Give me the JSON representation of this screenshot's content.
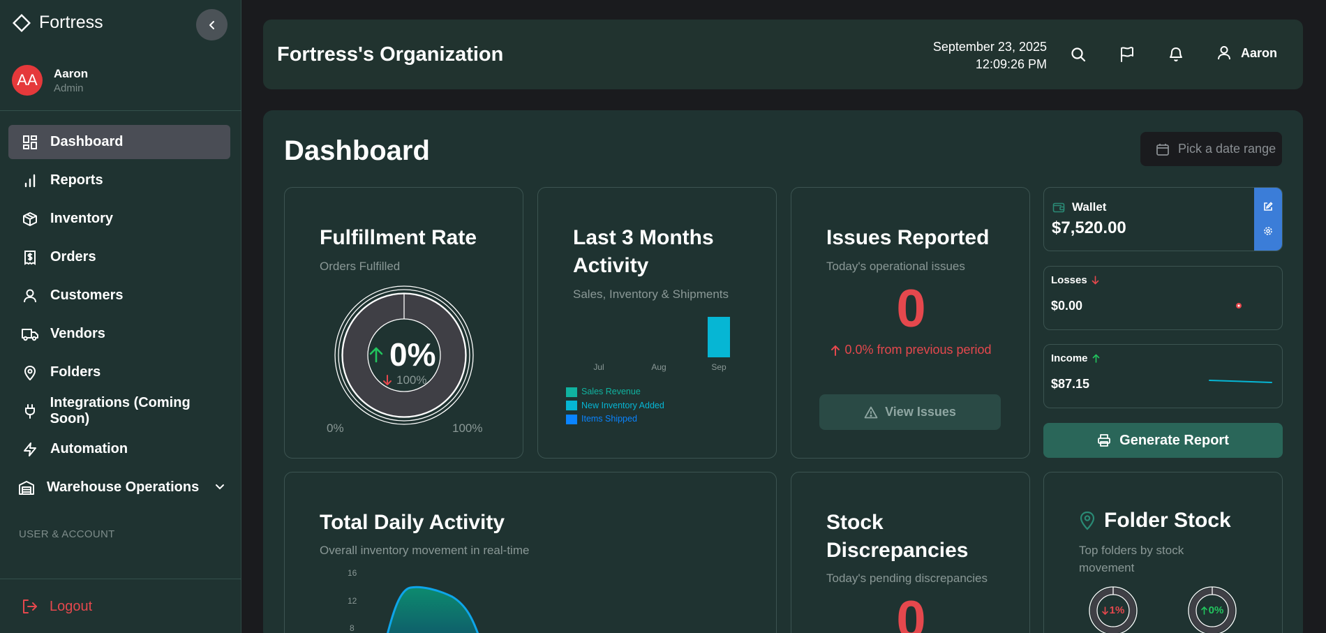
{
  "sidebar": {
    "brand": "Fortress",
    "user_name": "Aaron",
    "user_role": "Admin",
    "user_initials": "AA",
    "nav": [
      {
        "label": "Dashboard"
      },
      {
        "label": "Reports"
      },
      {
        "label": "Inventory"
      },
      {
        "label": "Orders"
      },
      {
        "label": "Customers"
      },
      {
        "label": "Vendors"
      },
      {
        "label": "Folders"
      },
      {
        "label": "Integrations (Coming Soon)"
      },
      {
        "label": "Automation"
      },
      {
        "label": "Warehouse Operations"
      }
    ],
    "section_label": "USER & ACCOUNT",
    "logout": "Logout"
  },
  "header": {
    "org_title": "Fortress's Organization",
    "date": "September 23, 2025",
    "time": "12:09:26 PM",
    "user": "Aaron"
  },
  "main": {
    "title": "Dashboard",
    "date_range_placeholder": "Pick a date range"
  },
  "fulfillment": {
    "title": "Fulfillment Rate",
    "subtitle": "Orders Fulfilled",
    "value": "0%",
    "change": "100%",
    "min_label": "0%",
    "max_label": "100%"
  },
  "activity": {
    "title_line1": "Last 3 Months",
    "title_line2": "Activity",
    "subtitle": "Sales, Inventory & Shipments",
    "legend": [
      "Sales Revenue",
      "New Inventory Added",
      "Items Shipped"
    ]
  },
  "issues": {
    "title": "Issues Reported",
    "subtitle": "Today's operational issues",
    "count": "0",
    "change": "0.0% from previous period",
    "button": "View Issues"
  },
  "wallet": {
    "label": "Wallet",
    "amount": "$7,520.00"
  },
  "losses": {
    "label": "Losses",
    "amount": "$0.00"
  },
  "income": {
    "label": "Income",
    "amount": "$87.15"
  },
  "generate_report": "Generate Report",
  "daily": {
    "title": "Total Daily Activity",
    "subtitle": "Overall inventory movement in real-time",
    "y_ticks": [
      "16",
      "12",
      "8"
    ]
  },
  "stock": {
    "title_line1": "Stock",
    "title_line2": "Discrepancies",
    "subtitle": "Today's pending discrepancies",
    "count": "0"
  },
  "folder_stock": {
    "title": "Folder Stock",
    "subtitle_line1": "Top folders by stock",
    "subtitle_line2": "movement",
    "items": [
      {
        "value": "1%"
      },
      {
        "value": "0%"
      }
    ]
  },
  "chart_data": [
    {
      "type": "bar",
      "categories": [
        "Jul",
        "Aug",
        "Sep"
      ],
      "series": [
        {
          "name": "Sales Revenue",
          "values": [
            0,
            0,
            0
          ]
        },
        {
          "name": "New Inventory Added",
          "values": [
            0,
            0,
            1
          ]
        },
        {
          "name": "Items Shipped",
          "values": [
            0,
            0,
            0
          ]
        }
      ],
      "colors": [
        "#10b3a0",
        "#06b6d4",
        "#0a84ff"
      ]
    },
    {
      "type": "area",
      "ylabel": "",
      "yticks": [
        16,
        12,
        8
      ],
      "color": "#0ea5e9"
    }
  ],
  "colors": {
    "accent_green": "#22c55e",
    "danger": "#e5484d",
    "primary_blue": "#3b7dd8",
    "button_green": "#2a6659"
  }
}
